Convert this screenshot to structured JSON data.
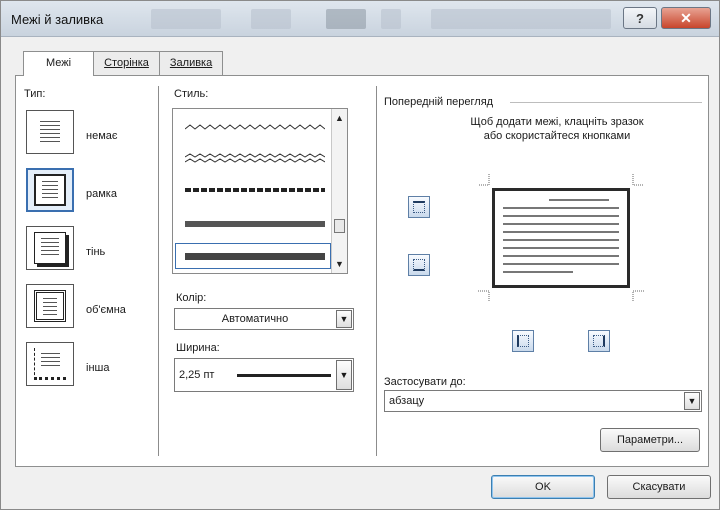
{
  "window": {
    "title": "Межі й заливка"
  },
  "tabs": [
    {
      "label": "Межі",
      "active": true
    },
    {
      "label": "Сторінка",
      "active": false
    },
    {
      "label": "Заливка",
      "active": false
    }
  ],
  "type_section": {
    "label": "Тип:",
    "items": [
      {
        "label": "немає",
        "icon": "none-border-icon",
        "selected": false
      },
      {
        "label": "рамка",
        "icon": "box-border-icon",
        "selected": true
      },
      {
        "label": "тінь",
        "icon": "shadow-border-icon",
        "selected": false
      },
      {
        "label": "об'ємна",
        "icon": "3d-border-icon",
        "selected": false
      },
      {
        "label": "інша",
        "icon": "custom-border-icon",
        "selected": false
      }
    ]
  },
  "style_section": {
    "label": "Стиль:",
    "styles": [
      "wavy",
      "double-wavy",
      "dash-dot-thick",
      "thick",
      "thick-selected"
    ]
  },
  "color": {
    "label": "Колір:",
    "value": "Автоматично"
  },
  "width": {
    "label": "Ширина:",
    "value": "2,25 пт"
  },
  "preview": {
    "label": "Попередній перегляд",
    "hint_line1": "Щоб додати межі, клацніть зразок",
    "hint_line2": "або скористайтеся кнопками"
  },
  "apply_to": {
    "label": "Застосувати до:",
    "value": "абзацу"
  },
  "buttons": {
    "options": "Параметри...",
    "ok": "OK",
    "cancel": "Скасувати"
  },
  "colors": {
    "accent": "#3a6fb0",
    "close": "#c8452c"
  }
}
